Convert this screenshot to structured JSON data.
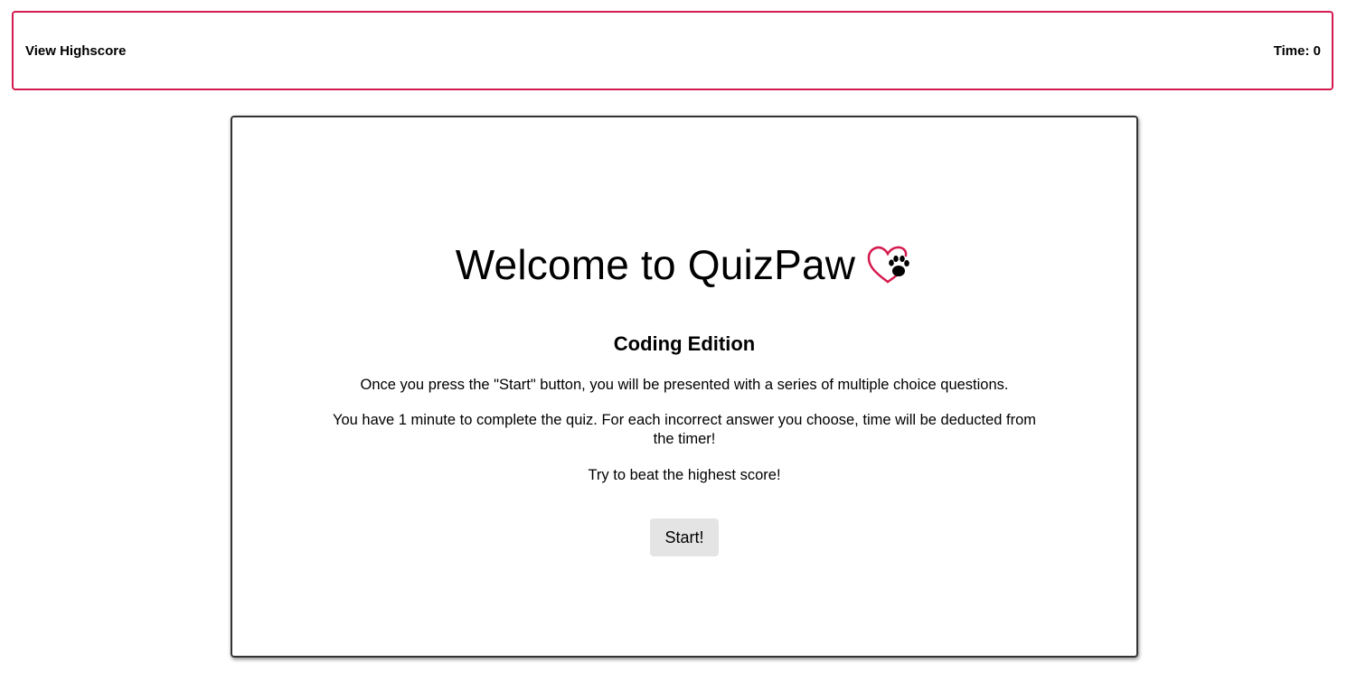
{
  "header": {
    "highscore_link": "View Highscore",
    "timer_text": "Time: 0",
    "border_color": "#d41a4e"
  },
  "main": {
    "title": "Welcome to QuizPaw",
    "logo_icon": "heart-paw-icon",
    "subtitle": "Coding Edition",
    "paragraphs": [
      "Once you press the \"Start\" button, you will be presented with a series of multiple choice questions.",
      "You have 1 minute to complete the quiz. For each incorrect answer you choose, time will be deducted from the timer!",
      "Try to beat the highest score!"
    ],
    "start_button": "Start!"
  },
  "colors": {
    "accent": "#d41a4e",
    "button_bg": "#e4e4e4"
  }
}
